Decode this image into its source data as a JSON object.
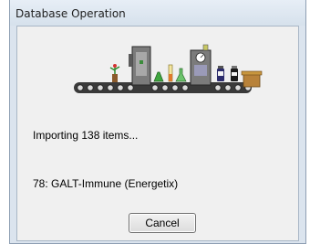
{
  "window": {
    "title": "Database Operation"
  },
  "progress": {
    "status_text": "Importing 138 items...",
    "current_item": "78: GALT-Immune (Energetix)"
  },
  "buttons": {
    "cancel_label": "Cancel"
  },
  "icons": {
    "animation": "conveyor-belt-bottling-icon"
  },
  "colors": {
    "window_frame": "#dbe4ee",
    "client_bg": "#f0f0f0"
  }
}
